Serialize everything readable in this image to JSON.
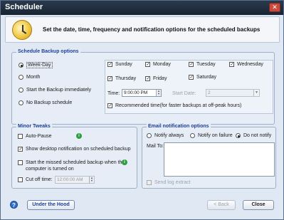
{
  "window": {
    "title": "Scheduler",
    "close_glyph": "✕"
  },
  "header": {
    "heading": "Set the date, time, frequency and notification options for the scheduled backups",
    "icon": "clock-icon"
  },
  "schedule": {
    "title": "Schedule Backup options",
    "options": [
      {
        "label": "Week-Day",
        "selected": true
      },
      {
        "label": "Month",
        "selected": false
      },
      {
        "label": "Start the Backup immediately",
        "selected": false
      },
      {
        "label": "No Backup schedule",
        "selected": false
      }
    ],
    "days": [
      {
        "label": "Sunday",
        "checked": true
      },
      {
        "label": "Monday",
        "checked": true
      },
      {
        "label": "Tuesday",
        "checked": true
      },
      {
        "label": "Wednesday",
        "checked": true
      },
      {
        "label": "Thursday",
        "checked": true
      },
      {
        "label": "Friday",
        "checked": true
      },
      {
        "label": "Saturday",
        "checked": true
      }
    ],
    "time_label": "Time:",
    "time_value": "9:00:00 PM",
    "start_date_label": "Start Date:",
    "start_date_value": "2",
    "recommended_label": "Recommended time(for faster backups at off-peak hours)"
  },
  "tweaks": {
    "title": "Minor Tweaks",
    "auto_pause": "Auto-Pause",
    "show_desktop": "Show desktop notification on scheduled backup",
    "start_missed_line1": "Start the missed scheduled backup when the",
    "start_missed_line2": "computer is turned on",
    "cut_off": "Cut off time:",
    "cut_off_value": "12:00:00 AM",
    "info_glyph": "i"
  },
  "email": {
    "title": "Email notification options",
    "notify_always": "Notify always",
    "notify_failure": "Notify on failure",
    "do_not_notify": "Do not notify",
    "mail_to": "Mail To:",
    "send_log": "Send log extract"
  },
  "footer": {
    "help_glyph": "?",
    "under_the_hood": "Under the Hood",
    "back": "< Back",
    "close": "Close"
  },
  "colors": {
    "accent": "#1b3f9a",
    "titlebar": "#172432",
    "panel": "#e6edf6"
  }
}
